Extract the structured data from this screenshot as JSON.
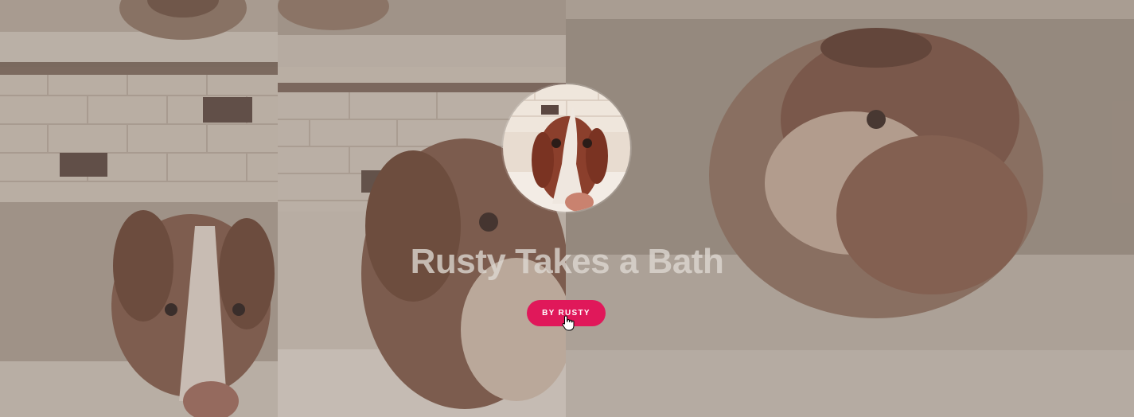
{
  "post": {
    "title": "Rusty Takes a Bath",
    "author_label": "BY RUSTY"
  },
  "icons": {
    "cursor": "hand-pointer-icon",
    "avatar": "dog-avatar"
  },
  "colors": {
    "accent": "#e0185a",
    "title_text": "#ded8d2",
    "background": "#9a8f84"
  }
}
